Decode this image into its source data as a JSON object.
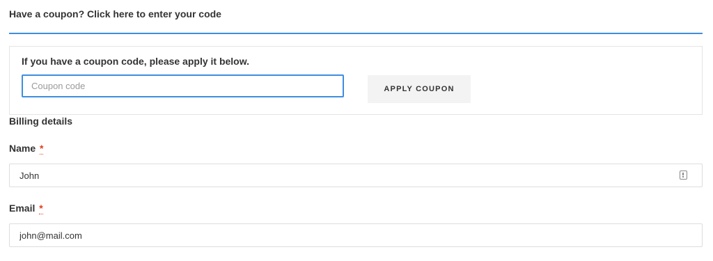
{
  "coupon": {
    "toggle_text": "Have a coupon? Click here to enter your code",
    "hint": "If you have a coupon code, please apply it below.",
    "input_placeholder": "Coupon code",
    "input_value": "",
    "apply_label": "APPLY COUPON"
  },
  "billing": {
    "title": "Billing details",
    "required_mark": "*",
    "name": {
      "label": "Name",
      "value": "John",
      "icon": "autofill-contact-icon"
    },
    "email": {
      "label": "Email",
      "value": "john@mail.com"
    }
  },
  "colors": {
    "accent": "#3f8ddf",
    "required": "#e2401c",
    "button_bg": "#f3f3f3",
    "text": "#333333"
  }
}
